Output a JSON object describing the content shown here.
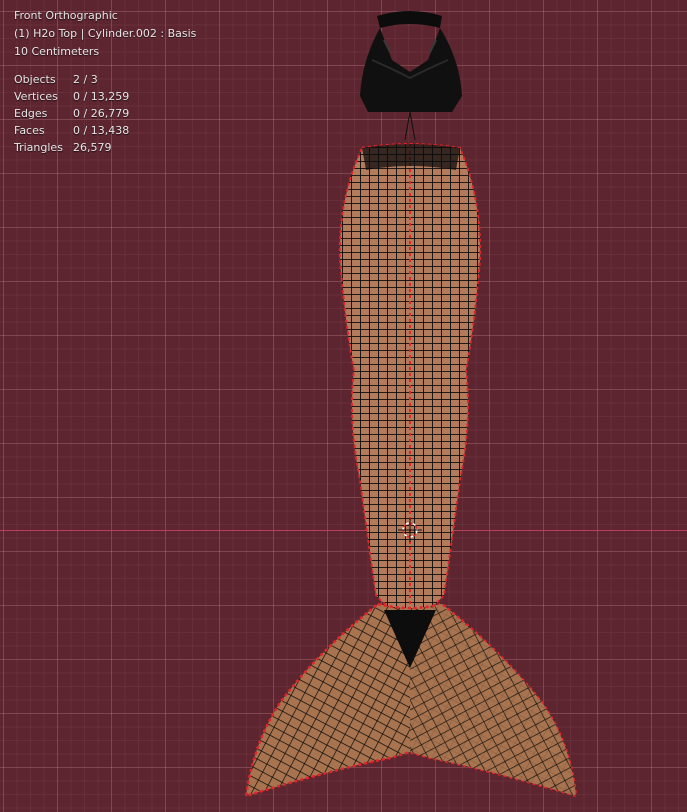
{
  "viewport": {
    "view_name": "Front Orthographic",
    "object_info": "(1) H2o Top | Cylinder.002 : Basis",
    "grid_scale": "10 Centimeters",
    "stats": [
      {
        "label": "Objects",
        "value": "2 / 3"
      },
      {
        "label": "Vertices",
        "value": "0 / 13,259"
      },
      {
        "label": "Edges",
        "value": "0 / 26,779"
      },
      {
        "label": "Faces",
        "value": "0 / 13,438"
      },
      {
        "label": "Triangles",
        "value": "26,579"
      }
    ]
  },
  "colors": {
    "background": "#5c2530",
    "x_axis": "#b2435a",
    "wire": "#0a0a0a",
    "skin": "#b07a5a",
    "selected_edge": "#e0252b"
  }
}
